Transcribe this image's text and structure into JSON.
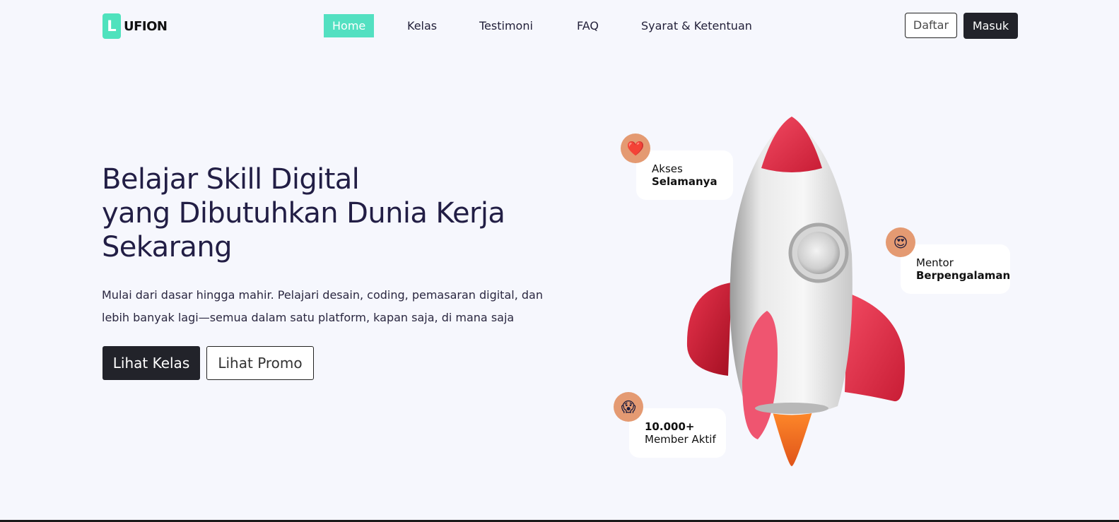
{
  "brand": {
    "logo_letter": "L",
    "name": "UFION",
    "accent_color": "#53e0c1"
  },
  "nav": {
    "items": [
      {
        "label": "Home",
        "active": true
      },
      {
        "label": "Kelas",
        "active": false
      },
      {
        "label": "Testimoni",
        "active": false
      },
      {
        "label": "FAQ",
        "active": false
      },
      {
        "label": "Syarat & Ketentuan",
        "active": false
      }
    ]
  },
  "auth": {
    "register_label": "Daftar",
    "login_label": "Masuk"
  },
  "hero": {
    "title_lines": [
      "Belajar Skill Digital",
      "yang Dibutuhkan Dunia Kerja",
      "Sekarang"
    ],
    "description": "Mulai dari dasar hingga mahir. Pelajari desain, coding, pemasaran digital, dan lebih banyak lagi—semua dalam satu platform, kapan saja, di mana saja",
    "primary_cta": "Lihat Kelas",
    "secondary_cta": "Lihat Promo"
  },
  "features": [
    {
      "icon": "heart-icon",
      "glyph": "❤️",
      "line1": "Akses",
      "line2": "Selamanya",
      "bold_line": 2
    },
    {
      "icon": "heart-eyes-emoji-icon",
      "glyph": "😍",
      "line1": "Mentor",
      "line2": "Berpengalaman",
      "bold_line": 2
    },
    {
      "icon": "shocked-emoji-icon",
      "glyph": "😱",
      "line1": "10.000+",
      "line2": "Member Aktif",
      "bold_line": 1
    }
  ]
}
